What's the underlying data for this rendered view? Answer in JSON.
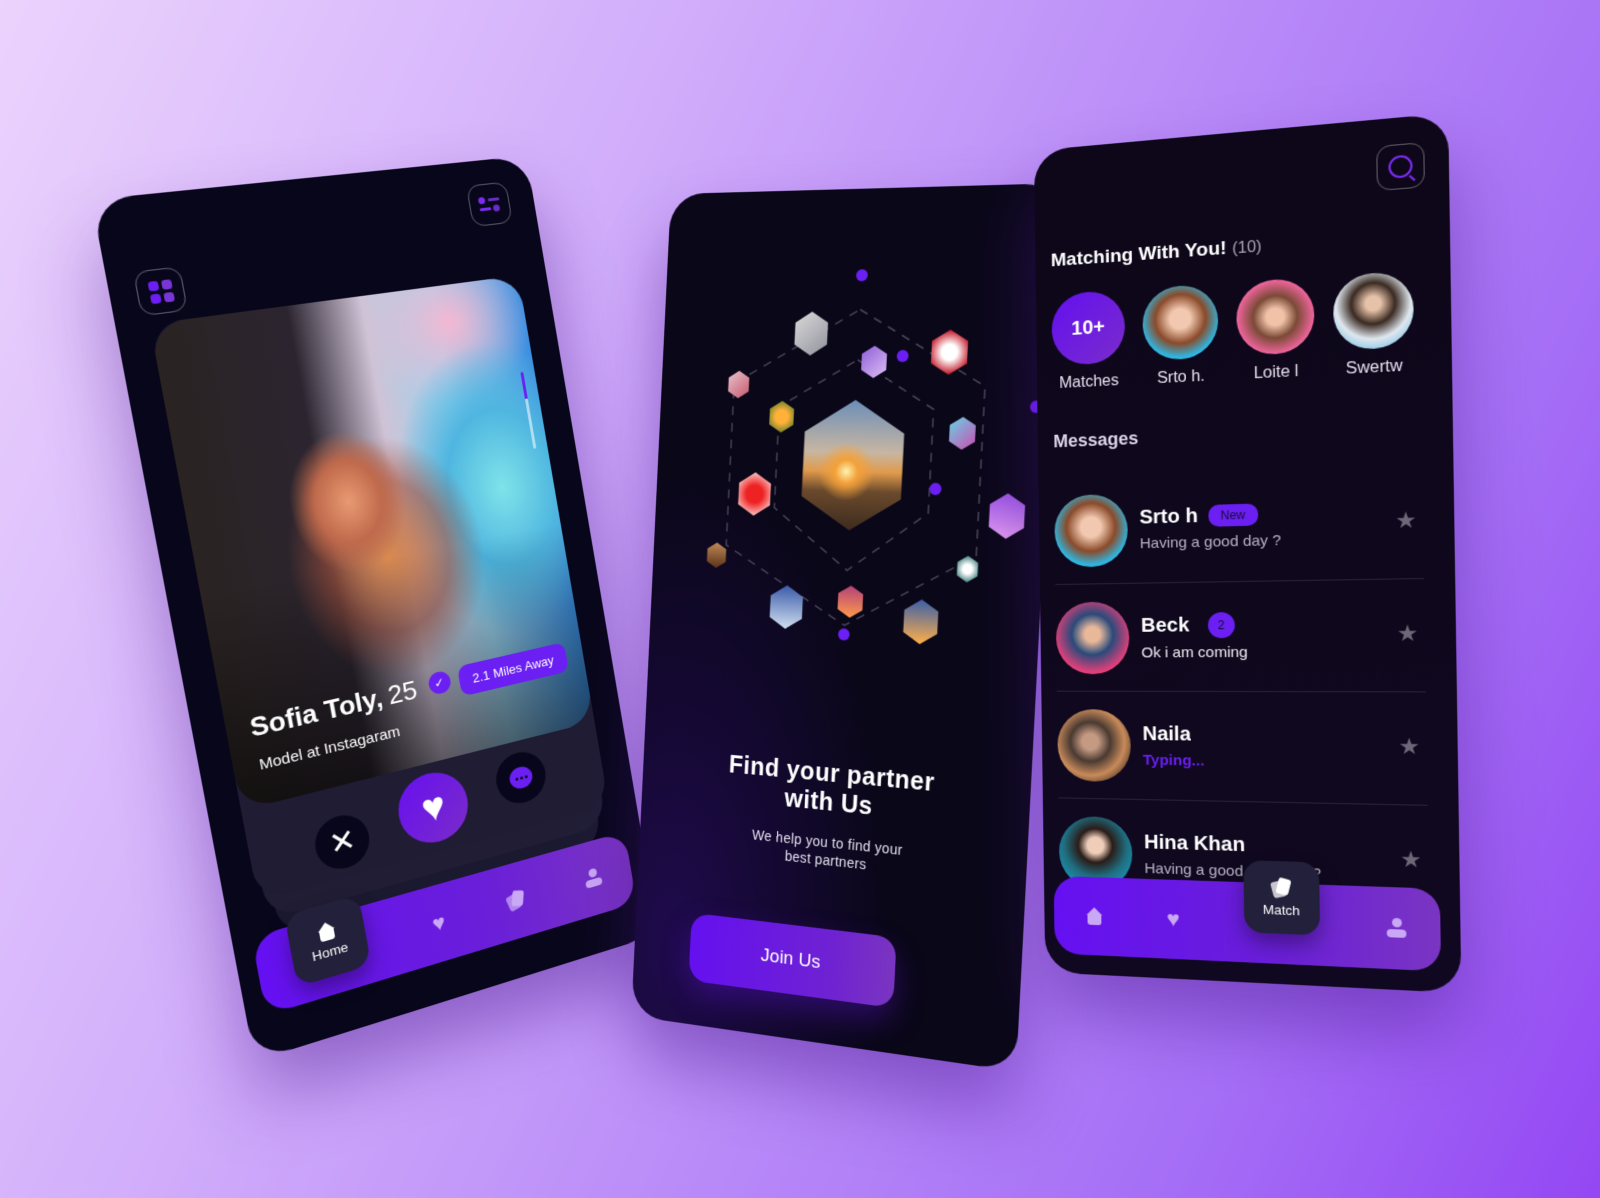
{
  "colors": {
    "accent": "#6b1ff2",
    "phone_bg": "#08061a",
    "card_bg": "#1f1c33",
    "star": "#6d6878",
    "background_start": "#ebd3fd",
    "background_end": "#9447f3"
  },
  "swipe_screen": {
    "menu_icon": "grid-icon",
    "filter_icon": "filter-icon",
    "profile": {
      "name": "Sofia Toly,",
      "age": "25",
      "verified_icon": "check-icon",
      "verified_glyph": "✓",
      "job": "Model at Instagaram",
      "distance": "2.1 Miles Away",
      "photo_progress": 0.35
    },
    "actions": {
      "dislike_icon": "close-icon",
      "dislike_glyph": "✕",
      "like_icon": "heart-icon",
      "like_glyph": "♥",
      "chat_icon": "chat-bubble-icon"
    },
    "tabbar": {
      "items": [
        {
          "icon": "home-icon",
          "label": "Home",
          "active": true
        },
        {
          "icon": "heart-icon",
          "glyph": "♥",
          "active": false
        },
        {
          "icon": "cards-icon",
          "active": false
        },
        {
          "icon": "user-icon",
          "active": false
        }
      ]
    }
  },
  "onboarding_screen": {
    "headline_line1": "Find your partner",
    "headline_line2": "with Us",
    "subtitle_line1": "We help you to find your",
    "subtitle_line2": "best partners",
    "cta_label": "Join Us"
  },
  "chat_screen": {
    "search_icon": "search-icon",
    "matching_title": "Matching With You!",
    "matching_count": "(10)",
    "matches": [
      {
        "label": "Matches",
        "badge": "10+"
      },
      {
        "label": "Srto h."
      },
      {
        "label": "Loite l"
      },
      {
        "label": "Swertw"
      }
    ],
    "messages_title": "Messages",
    "messages": [
      {
        "name": "Srto h",
        "badge": "New",
        "preview": "Having a good day ?",
        "starred": false
      },
      {
        "name": "Beck",
        "count": "2",
        "preview": "Ok i am coming",
        "starred": false
      },
      {
        "name": "Naila",
        "preview": "Typing...",
        "typing": true,
        "starred": false
      },
      {
        "name": "Hina Khan",
        "preview": "Having a good day Beck?",
        "starred": false
      }
    ],
    "star_glyph": "★",
    "tabbar": {
      "items": [
        {
          "icon": "home-icon",
          "active": false
        },
        {
          "icon": "heart-icon",
          "glyph": "♥",
          "active": false
        },
        {
          "icon": "cards-icon",
          "label": "Match",
          "active": true
        },
        {
          "icon": "user-icon",
          "active": false
        }
      ]
    }
  }
}
